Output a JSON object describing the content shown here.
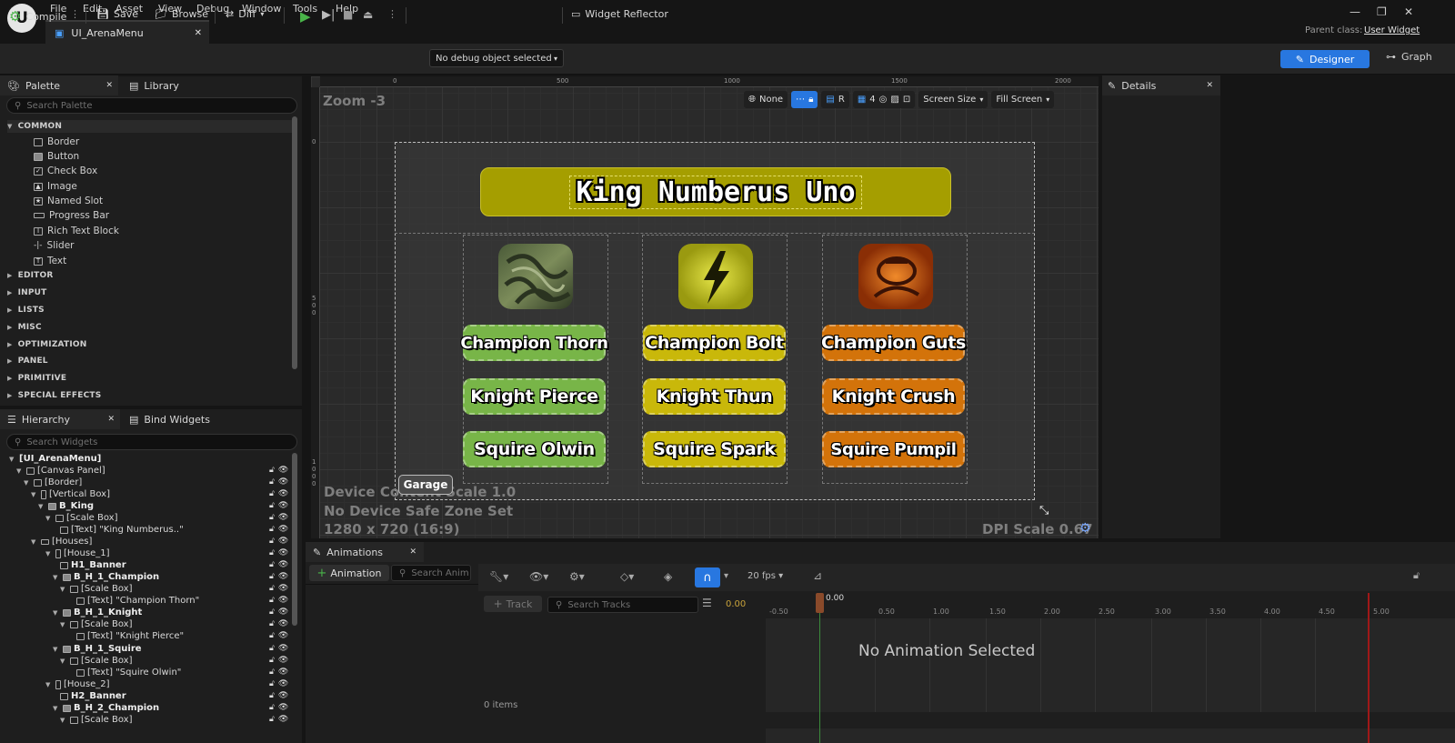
{
  "menu": [
    "File",
    "Edit",
    "Asset",
    "View",
    "Debug",
    "Window",
    "Tools",
    "Help"
  ],
  "logo": "U",
  "tab": {
    "title": "UI_ArenaMenu",
    "close": "✕"
  },
  "parent_class": {
    "label": "Parent class:",
    "value": "User Widget"
  },
  "toolbar": {
    "compile": "Compile",
    "save": "Save",
    "browse": "Browse",
    "diff": "Diff",
    "debug_object": "No debug object selected",
    "widget_reflector": "Widget Reflector",
    "designer": "Designer",
    "graph": "Graph"
  },
  "palette": {
    "tab": "Palette",
    "library_tab": "Library",
    "search_placeholder": "Search Palette",
    "common_label": "COMMON",
    "common_items": [
      "Border",
      "Button",
      "Check Box",
      "Image",
      "Named Slot",
      "Progress Bar",
      "Rich Text Block",
      "Slider",
      "Text"
    ],
    "categories": [
      "EDITOR",
      "INPUT",
      "LISTS",
      "MISC",
      "OPTIMIZATION",
      "PANEL",
      "PRIMITIVE",
      "SPECIAL EFFECTS"
    ]
  },
  "hierarchy": {
    "tab": "Hierarchy",
    "bind_tab": "Bind Widgets",
    "search_placeholder": "Search Widgets",
    "rows": [
      "[UI_ArenaMenu]",
      "[Canvas Panel]",
      "[Border]",
      "[Vertical Box]",
      "B_King",
      "[Scale Box]",
      "[Text] \"King Numberus..\"",
      "[Houses]",
      "[House_1]",
      "H1_Banner",
      "B_H_1_Champion",
      "[Scale Box]",
      "[Text] \"Champion Thorn\"",
      "B_H_1_Knight",
      "[Scale Box]",
      "[Text] \"Knight Pierce\"",
      "B_H_1_Squire",
      "[Scale Box]",
      "[Text] \"Squire Olwin\"",
      "[House_2]",
      "H2_Banner",
      "B_H_2_Champion",
      "[Scale Box]"
    ]
  },
  "viewport": {
    "zoom": "Zoom -3",
    "ruler_top": [
      "0",
      "500",
      "1000",
      "1500",
      "2000"
    ],
    "ruler_left": [
      "0",
      "5\n0\n0",
      "1\n0\n0\n0"
    ],
    "tools": {
      "none": "None",
      "r": "R",
      "grid": "4",
      "screen_size": "Screen Size",
      "fill_screen": "Fill Screen"
    },
    "device_lines": [
      "Device Content Scale 1.0",
      "No Device Safe Zone Set",
      "1280 x 720 (16:9)"
    ],
    "dpi": "DPI Scale 0.67"
  },
  "arena": {
    "title": "King Numberus Uno",
    "houses": [
      {
        "buttons": [
          "Champion Thorn",
          "Knight Pierce",
          "Squire Olwin"
        ],
        "color": "#78b548"
      },
      {
        "buttons": [
          "Champion Bolt",
          "Knight Thun",
          "Squire Spark"
        ],
        "color": "#c9b80a"
      },
      {
        "buttons": [
          "Champion Guts",
          "Knight Crush",
          "Squire Pumpil"
        ],
        "color": "#d3730a"
      }
    ],
    "garage": "Garage"
  },
  "details": {
    "tab": "Details"
  },
  "animations": {
    "tab": "Animations",
    "add_button": "Animation",
    "search_placeholder": "Search Anim",
    "track_button": "Track",
    "search_tracks_placeholder": "Search Tracks",
    "fps": "20 fps",
    "time": "0.00",
    "playhead": "0.00",
    "empty": "No Animation Selected",
    "items": "0 items",
    "ticks": [
      "-0.50",
      "0.50",
      "1.00",
      "1.50",
      "2.00",
      "2.50",
      "3.00",
      "3.50",
      "4.00",
      "4.50",
      "5.00"
    ]
  }
}
